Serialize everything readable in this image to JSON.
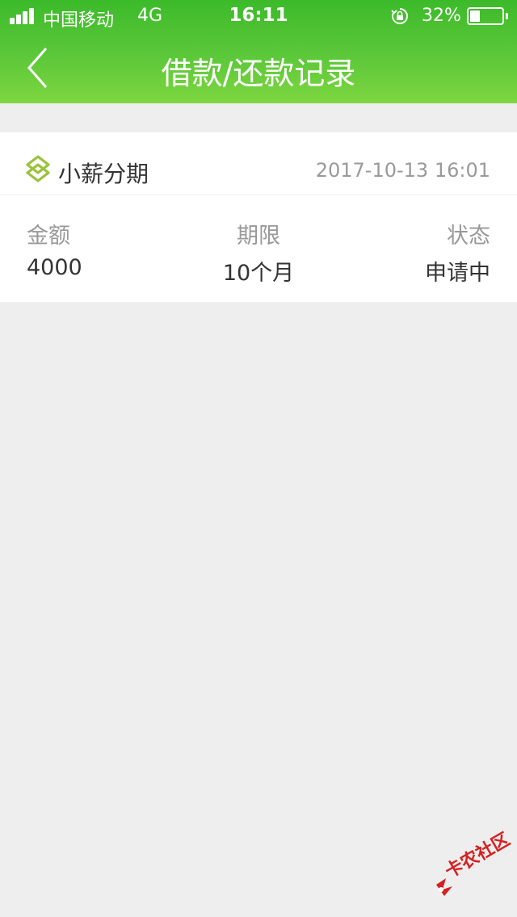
{
  "status_bar": {
    "carrier": "中国移动",
    "network": "4G",
    "time": "16:11",
    "battery_percent": "32%",
    "battery_level": 0.32
  },
  "nav": {
    "title": "借款/还款记录",
    "back_icon": "chevron-left-icon"
  },
  "record": {
    "brand_name": "小薪分期",
    "brand_icon": "xiaoxin-logo-icon",
    "date": "2017-10-13 16:01",
    "columns": [
      {
        "label": "金额",
        "value": "4000"
      },
      {
        "label": "期限",
        "value": "10个月"
      },
      {
        "label": "状态",
        "value": "申请中"
      }
    ]
  },
  "watermark": {
    "text": "卡农社区"
  },
  "colors": {
    "header_top": "#3cba2a",
    "header_bottom": "#7ed63f",
    "brand_icon": "#9bc23c",
    "background": "#eeeeee"
  }
}
